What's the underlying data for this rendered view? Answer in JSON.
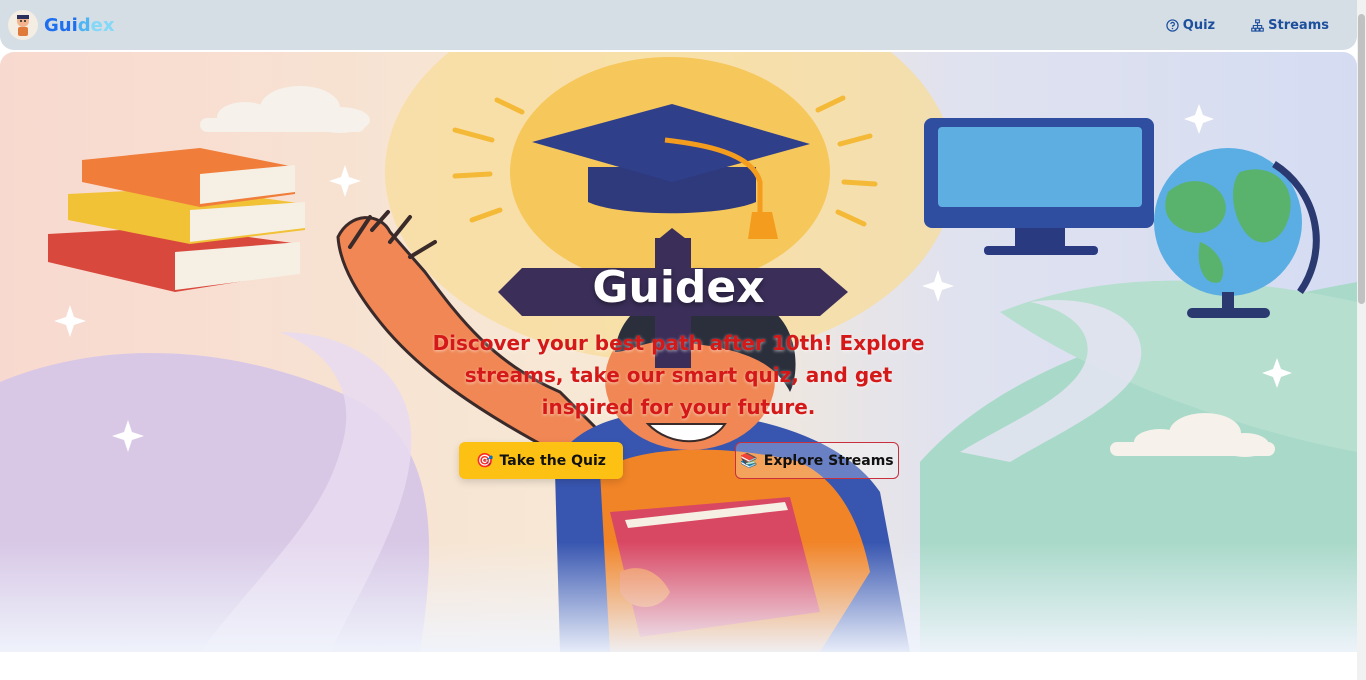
{
  "brand": {
    "name_part1": "Gui",
    "name_part2": "d",
    "name_part3": "ex",
    "logo_icon": "mascot-logo"
  },
  "nav": {
    "quiz_label": "Quiz",
    "quiz_icon": "help-circle-icon",
    "streams_label": "Streams",
    "streams_icon": "sitemap-icon"
  },
  "hero": {
    "title": "Guidex",
    "subtitle": "Discover your best path after 10th! Explore streams, take our smart quiz, and get inspired for your future.",
    "quiz_button": {
      "emoji": "🎯",
      "label": "Take the Quiz"
    },
    "streams_button": {
      "emoji": "📚",
      "label": "Explore Streams"
    }
  },
  "colors": {
    "accent": "#fdc113",
    "subtitle": "#d51818",
    "nav_text": "#1c4f9c",
    "navbar_bg": "#d5dde5"
  }
}
